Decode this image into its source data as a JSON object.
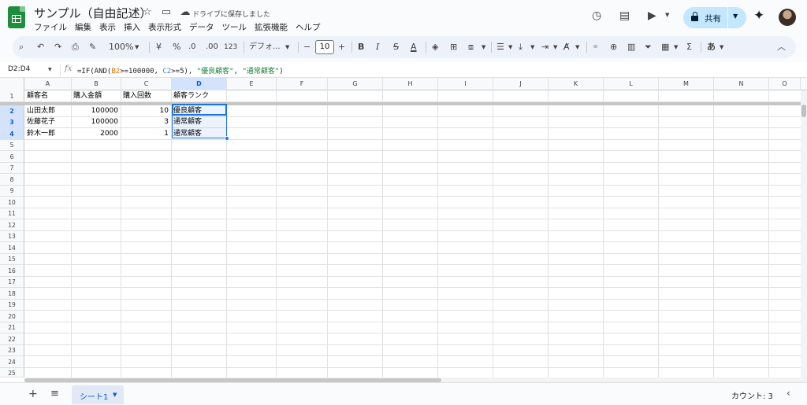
{
  "app": {
    "doc_title": "サンプル（自由記述）",
    "save_status": "ドライブに保存しました",
    "menu": [
      "ファイル",
      "編集",
      "表示",
      "挿入",
      "表示形式",
      "データ",
      "ツール",
      "拡張機能",
      "ヘルプ"
    ],
    "share_label": "共有"
  },
  "toolbar": {
    "zoom": "100%",
    "currency": "¥",
    "percent": "%",
    "dec_decrease": ".0",
    "dec_increase": ".00",
    "format_123": "123",
    "font": "デフォ...",
    "font_size": "10",
    "input_tool": "あ"
  },
  "formula_bar": {
    "name_box": "D2:D4",
    "fx": "fx",
    "f_prefix": "=IF(AND(",
    "f_ref1": "B2",
    "f_mid1": ">=100000, ",
    "f_ref2": "C2",
    "f_mid2": ">=5), ",
    "f_str1": "\"優良顧客\"",
    "f_comma": ", ",
    "f_str2": "\"通常顧客\"",
    "f_end": ")"
  },
  "sheet": {
    "columns": [
      "A",
      "B",
      "C",
      "D",
      "E",
      "F",
      "G",
      "H",
      "I",
      "J",
      "K",
      "L",
      "M",
      "N",
      "O"
    ],
    "rows": [
      "1",
      "2",
      "3",
      "4",
      "5",
      "6",
      "7",
      "8",
      "9",
      "10",
      "11",
      "12",
      "13",
      "14",
      "15",
      "16",
      "17",
      "18",
      "19",
      "20",
      "21",
      "22",
      "23",
      "24",
      "25"
    ],
    "header": [
      "顧客名",
      "購入金額",
      "購入回数",
      "顧客ランク"
    ],
    "data": [
      [
        "山田太郎",
        "100000",
        "10",
        "優良顧客"
      ],
      [
        "佐藤花子",
        "100000",
        "3",
        "通常顧客"
      ],
      [
        "鈴木一郎",
        "2000",
        "1",
        "通常顧客"
      ]
    ]
  },
  "bottom": {
    "sheet_tab": "シート1",
    "status": "カウント: 3"
  }
}
